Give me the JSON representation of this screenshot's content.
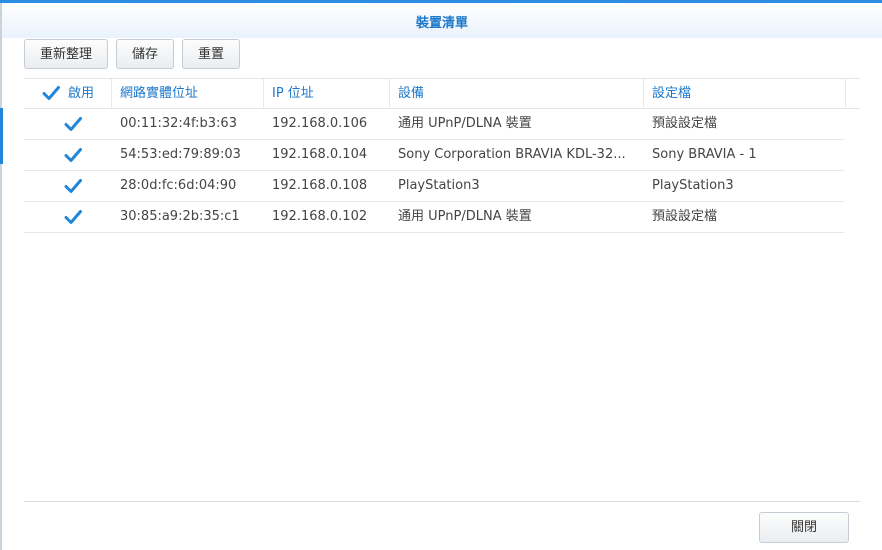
{
  "dialog": {
    "title": "裝置清單"
  },
  "toolbar": {
    "refresh_label": "重新整理",
    "save_label": "儲存",
    "reset_label": "重置"
  },
  "table": {
    "columns": [
      "啟用",
      "網路實體位址",
      "IP 位址",
      "設備",
      "設定檔"
    ],
    "rows": [
      {
        "enabled": true,
        "mac": "00:11:32:4f:b3:63",
        "ip": "192.168.0.106",
        "device": "通用 UPnP/DLNA 裝置",
        "profile": "預設設定檔"
      },
      {
        "enabled": true,
        "mac": "54:53:ed:79:89:03",
        "ip": "192.168.0.104",
        "device": "Sony Corporation BRAVIA KDL-32...",
        "profile": "Sony BRAVIA - 1"
      },
      {
        "enabled": true,
        "mac": "28:0d:fc:6d:04:90",
        "ip": "192.168.0.108",
        "device": "PlayStation3",
        "profile": "PlayStation3"
      },
      {
        "enabled": true,
        "mac": "30:85:a9:2b:35:c1",
        "ip": "192.168.0.102",
        "device": "通用 UPnP/DLNA 裝置",
        "profile": "預設設定檔"
      }
    ]
  },
  "footer": {
    "close_label": "關閉"
  },
  "colors": {
    "accent": "#1d78c9",
    "check": "#1f86d9"
  },
  "icons": {
    "checkbox": "checkmark-icon"
  }
}
